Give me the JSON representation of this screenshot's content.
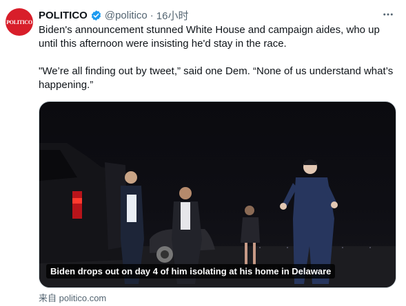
{
  "account": {
    "avatar_text": "POLITICO",
    "name": "POLITICO",
    "handle": "@politico",
    "separator": "·",
    "time": "16小时"
  },
  "tweet": {
    "paragraph1": "Biden's announcement stunned White House and campaign aides, who up until this afternoon were insisting he'd stay in the race.",
    "paragraph2": "\"We’re all finding out by tweet,” said one Dem. “None of us understand what’s happening.”"
  },
  "media": {
    "caption": "Biden drops out on day 4 of him isolating at his home in Delaware"
  },
  "card": {
    "source": "来自 politico.com"
  },
  "icons": {
    "verified": "verified-badge-icon",
    "more": "more-options-icon"
  },
  "colors": {
    "brand": "#d81e2a",
    "verified": "#1d9bf0",
    "secondary_text": "#536471"
  }
}
